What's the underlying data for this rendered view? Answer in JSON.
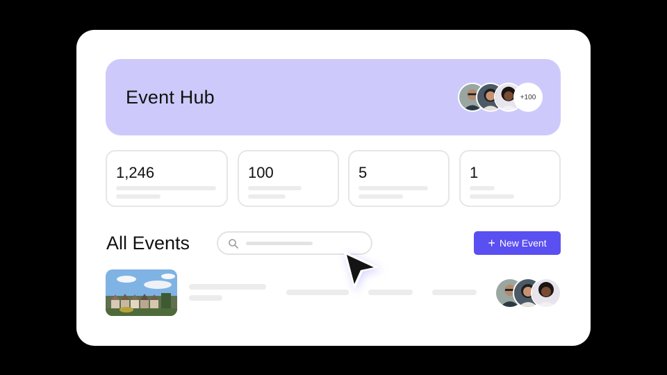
{
  "hero": {
    "title": "Event Hub",
    "more_count": "+100",
    "avatars": [
      "avatar-man-glasses",
      "avatar-woman-curly",
      "avatar-woman-afro"
    ]
  },
  "stats": [
    {
      "value": "1,246"
    },
    {
      "value": "100"
    },
    {
      "value": "5"
    },
    {
      "value": "1"
    }
  ],
  "events_section": {
    "title": "All Events",
    "search_icon": "search-icon",
    "new_button": {
      "icon": "plus-icon",
      "label": "New Event"
    }
  },
  "event_row": {
    "thumbnail": "townhouses-photo",
    "avatars": [
      "avatar-man-glasses",
      "avatar-woman-curly",
      "avatar-woman-afro"
    ]
  },
  "colors": {
    "hero_bg": "#cdcafb",
    "accent": "#5a4ff0",
    "placeholder_bar": "#ececec"
  }
}
